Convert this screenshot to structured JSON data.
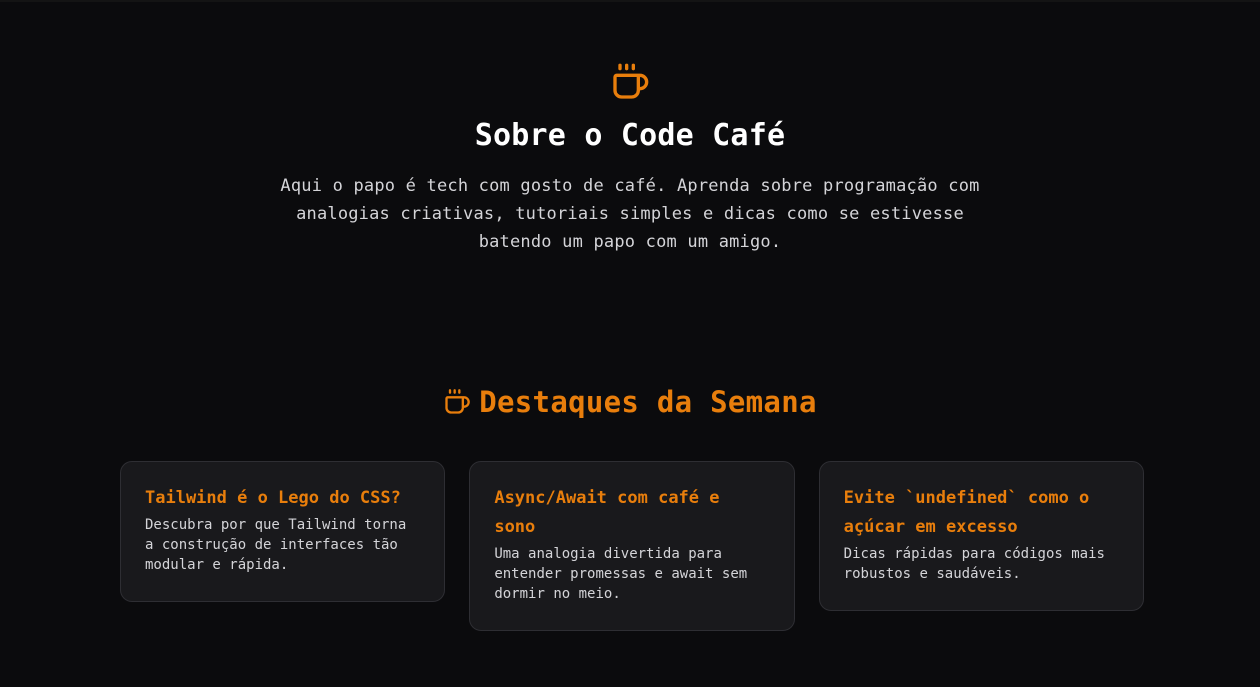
{
  "about": {
    "icon": "coffee-cup-icon",
    "title": "Sobre o Code Café",
    "text": "Aqui o papo é tech com gosto de café. Aprenda sobre programação com analogias criativas, tutoriais simples e dicas como se estivesse batendo um papo com um amigo."
  },
  "highlights": {
    "icon": "coffee-cup-icon",
    "title": "Destaques da Semana",
    "cards": [
      {
        "title": "Tailwind é o Lego do CSS?",
        "description": "Descubra por que Tailwind torna a construção de interfaces tão modular e rápida."
      },
      {
        "title": "Async/Await com café e sono",
        "description": "Uma analogia divertida para entender promessas e await sem dormir no meio."
      },
      {
        "title": "Evite `undefined` como o açúcar em excesso",
        "description": "Dicas rápidas para códigos mais robustos e saudáveis."
      }
    ]
  },
  "colors": {
    "background": "#0b0b0d",
    "accent": "#e87e0c",
    "card_background": "#19191c",
    "card_border": "#2e2e33",
    "heading_text": "#ffffff",
    "body_text": "#d4d4d8"
  }
}
